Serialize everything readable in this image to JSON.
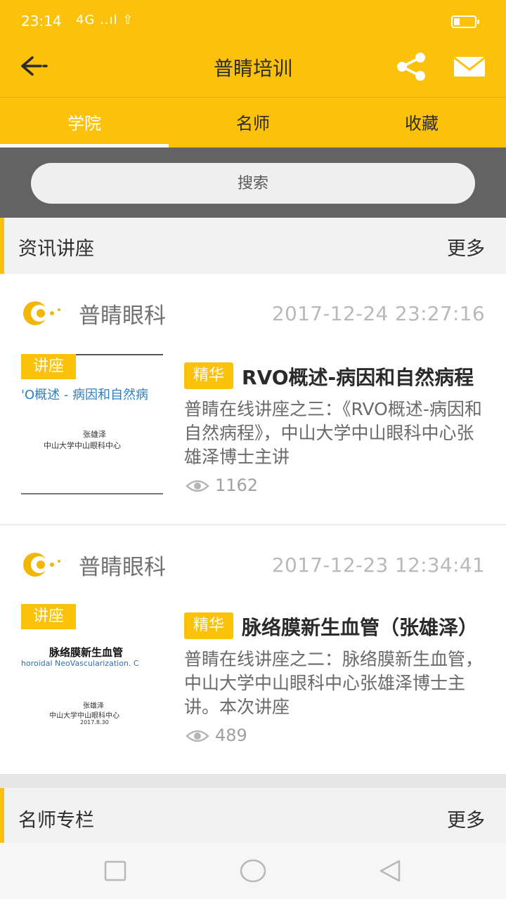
{
  "status": {
    "time": "23:14",
    "signal": "4G ..ıl ⇧"
  },
  "appbar": {
    "title": "普睛培训"
  },
  "tabs": [
    {
      "label": "学院",
      "active": true
    },
    {
      "label": "名师",
      "active": false
    },
    {
      "label": "收藏",
      "active": false
    }
  ],
  "search": {
    "placeholder": "搜索"
  },
  "sections": {
    "lectures": {
      "title": "资讯讲座",
      "more": "更多"
    },
    "masters": {
      "title": "名师专栏",
      "more": "更多"
    }
  },
  "items": [
    {
      "org": "普睛眼科",
      "time": "2017-12-24 23:27:16",
      "tag": "讲座",
      "badge": "精华",
      "title": "RVO概述-病因和自然病程",
      "desc": "普睛在线讲座之三：《RVO概述-病因和自然病程》，中山大学中山眼科中心张雄泽博士主讲",
      "views": "1162",
      "thumb_title": "'O概述 - 病因和自然病",
      "thumb_author": "张雄泽",
      "thumb_org": "中山大学中山眼科中心"
    },
    {
      "org": "普睛眼科",
      "time": "2017-12-23 12:34:41",
      "tag": "讲座",
      "badge": "精华",
      "title": "脉络膜新生血管（张雄泽）",
      "desc": "普睛在线讲座之二：脉络膜新生血管，中山大学中山眼科中心张雄泽博士主讲。本次讲座",
      "views": "489",
      "thumb_title": "脉络膜新生血管",
      "thumb_subtitle": "horoidal NeoVascularization.  C",
      "thumb_author": "张雄泽",
      "thumb_org": "中山大学中山眼科中心",
      "thumb_date": "2017.8.30"
    }
  ],
  "colors": {
    "accent": "#fcc10a",
    "search_band": "#636363",
    "section_bg": "#f2f2f2"
  },
  "icons": [
    "back-arrow-icon",
    "share-icon",
    "mail-icon",
    "eye-icon",
    "logo-icon",
    "nav-square-icon",
    "nav-circle-icon",
    "nav-triangle-icon"
  ]
}
